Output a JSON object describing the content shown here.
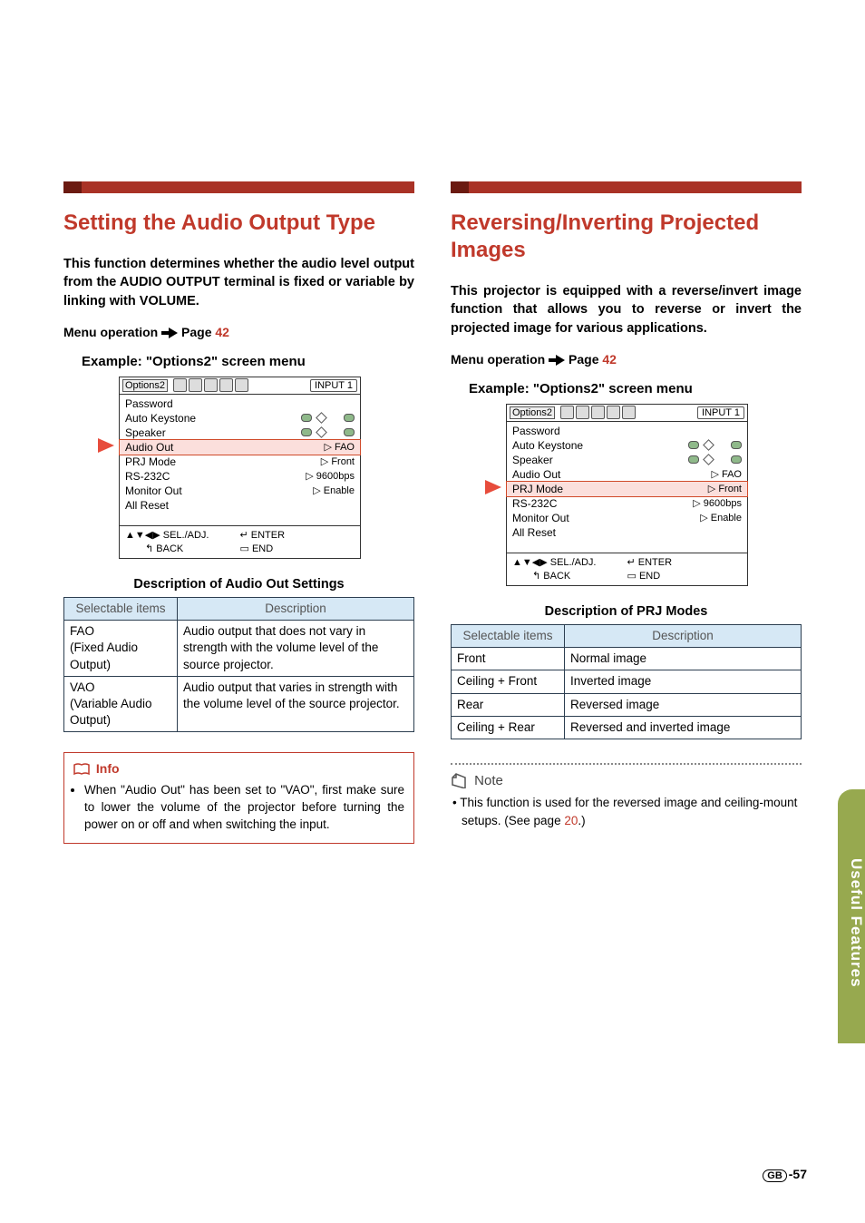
{
  "side_tab": "Useful Features",
  "page_number": {
    "prefix": "GB",
    "num": "-57"
  },
  "left": {
    "title": "Setting the Audio Output Type",
    "intro": "This function determines whether the audio level output from the AUDIO OUTPUT terminal is fixed or variable by linking with VOLUME.",
    "menu_op_label": "Menu operation",
    "menu_op_page_label": "Page",
    "menu_op_page_ref": "42",
    "example_label": "Example: \"Options2\" screen menu",
    "screen": {
      "tab": "Options2",
      "input": "INPUT 1",
      "highlight_index": 3,
      "rows": [
        {
          "label": "Password",
          "val": ""
        },
        {
          "label": "Auto Keystone",
          "val": "pill-diamond"
        },
        {
          "label": "Speaker",
          "val": "pill-diamond"
        },
        {
          "label": "Audio Out",
          "val": "▷ FAO"
        },
        {
          "label": "PRJ Mode",
          "val": "▷ Front"
        },
        {
          "label": "RS-232C",
          "val": "▷ 9600bps"
        },
        {
          "label": "Monitor Out",
          "val": "▷ Enable"
        },
        {
          "label": "All Reset",
          "val": ""
        }
      ],
      "footer": {
        "sel": "▲▼◀▶ SEL./ADJ.",
        "enter": "↵ ENTER",
        "back": "↰ BACK",
        "end": "▭ END"
      }
    },
    "table_caption": "Description of Audio Out Settings",
    "table_headers": [
      "Selectable items",
      "Description"
    ],
    "table_rows": [
      {
        "item": "FAO\n(Fixed Audio Output)",
        "desc": "Audio output that does not vary in strength with the volume level of the source projector."
      },
      {
        "item": "VAO\n(Variable Audio Output)",
        "desc": "Audio output that varies in strength with the volume level of the source projector."
      }
    ],
    "info_title": "Info",
    "info_text": "When \"Audio Out\" has been set to \"VAO\", first make sure to lower the volume of the projector before turning the power on or off and when switching the input."
  },
  "right": {
    "title": "Reversing/Inverting Projected Images",
    "intro": "This projector is equipped with a reverse/invert image function that allows you to reverse or invert the projected image for various applications.",
    "menu_op_label": "Menu operation",
    "menu_op_page_label": "Page",
    "menu_op_page_ref": "42",
    "example_label": "Example: \"Options2\" screen menu",
    "screen": {
      "tab": "Options2",
      "input": "INPUT 1",
      "highlight_index": 4,
      "rows": [
        {
          "label": "Password",
          "val": ""
        },
        {
          "label": "Auto Keystone",
          "val": "pill-diamond"
        },
        {
          "label": "Speaker",
          "val": "pill-diamond"
        },
        {
          "label": "Audio Out",
          "val": "▷ FAO"
        },
        {
          "label": "PRJ Mode",
          "val": "▷ Front"
        },
        {
          "label": "RS-232C",
          "val": "▷ 9600bps"
        },
        {
          "label": "Monitor Out",
          "val": "▷ Enable"
        },
        {
          "label": "All Reset",
          "val": ""
        }
      ],
      "footer": {
        "sel": "▲▼◀▶ SEL./ADJ.",
        "enter": "↵ ENTER",
        "back": "↰ BACK",
        "end": "▭ END"
      }
    },
    "table_caption": "Description of PRJ Modes",
    "table_headers": [
      "Selectable items",
      "Description"
    ],
    "table_rows": [
      {
        "item": "Front",
        "desc": "Normal image"
      },
      {
        "item": "Ceiling + Front",
        "desc": "Inverted image"
      },
      {
        "item": "Rear",
        "desc": "Reversed image"
      },
      {
        "item": "Ceiling + Rear",
        "desc": "Reversed and inverted image"
      }
    ],
    "note_title": "Note",
    "note_text_pre": "• This function is used for the reversed image and ceiling-mount setups. (See page ",
    "note_page_ref": "20",
    "note_text_post": ".)"
  }
}
